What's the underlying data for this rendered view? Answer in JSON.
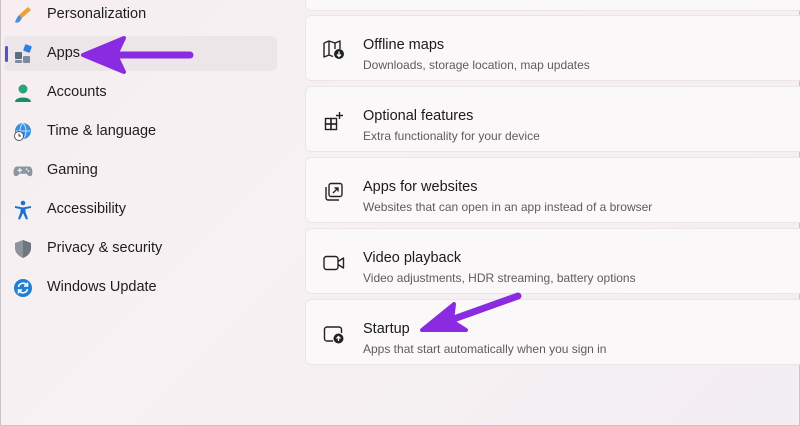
{
  "sidebar": {
    "items": [
      {
        "label": "Personalization",
        "icon": "brush-icon"
      },
      {
        "label": "Apps",
        "icon": "apps-icon",
        "selected": true
      },
      {
        "label": "Accounts",
        "icon": "person-icon"
      },
      {
        "label": "Time & language",
        "icon": "clock-globe-icon"
      },
      {
        "label": "Gaming",
        "icon": "gamepad-icon"
      },
      {
        "label": "Accessibility",
        "icon": "accessibility-icon"
      },
      {
        "label": "Privacy & security",
        "icon": "shield-icon"
      },
      {
        "label": "Windows Update",
        "icon": "refresh-icon"
      }
    ]
  },
  "main": {
    "cards": [
      {
        "title": "",
        "desc": ""
      },
      {
        "title": "Offline maps",
        "desc": "Downloads, storage location, map updates",
        "icon": "map-download-icon"
      },
      {
        "title": "Optional features",
        "desc": "Extra functionality for your device",
        "icon": "grid-plus-icon"
      },
      {
        "title": "Apps for websites",
        "desc": "Websites that can open in an app instead of a browser",
        "icon": "open-in-app-icon"
      },
      {
        "title": "Video playback",
        "desc": "Video adjustments, HDR streaming, battery options",
        "icon": "video-camera-icon"
      },
      {
        "title": "Startup",
        "desc": "Apps that start automatically when you sign in",
        "icon": "startup-icon"
      }
    ]
  },
  "colors": {
    "accent": "#5a4fcf",
    "annotation_arrow": "#8a2be2"
  }
}
